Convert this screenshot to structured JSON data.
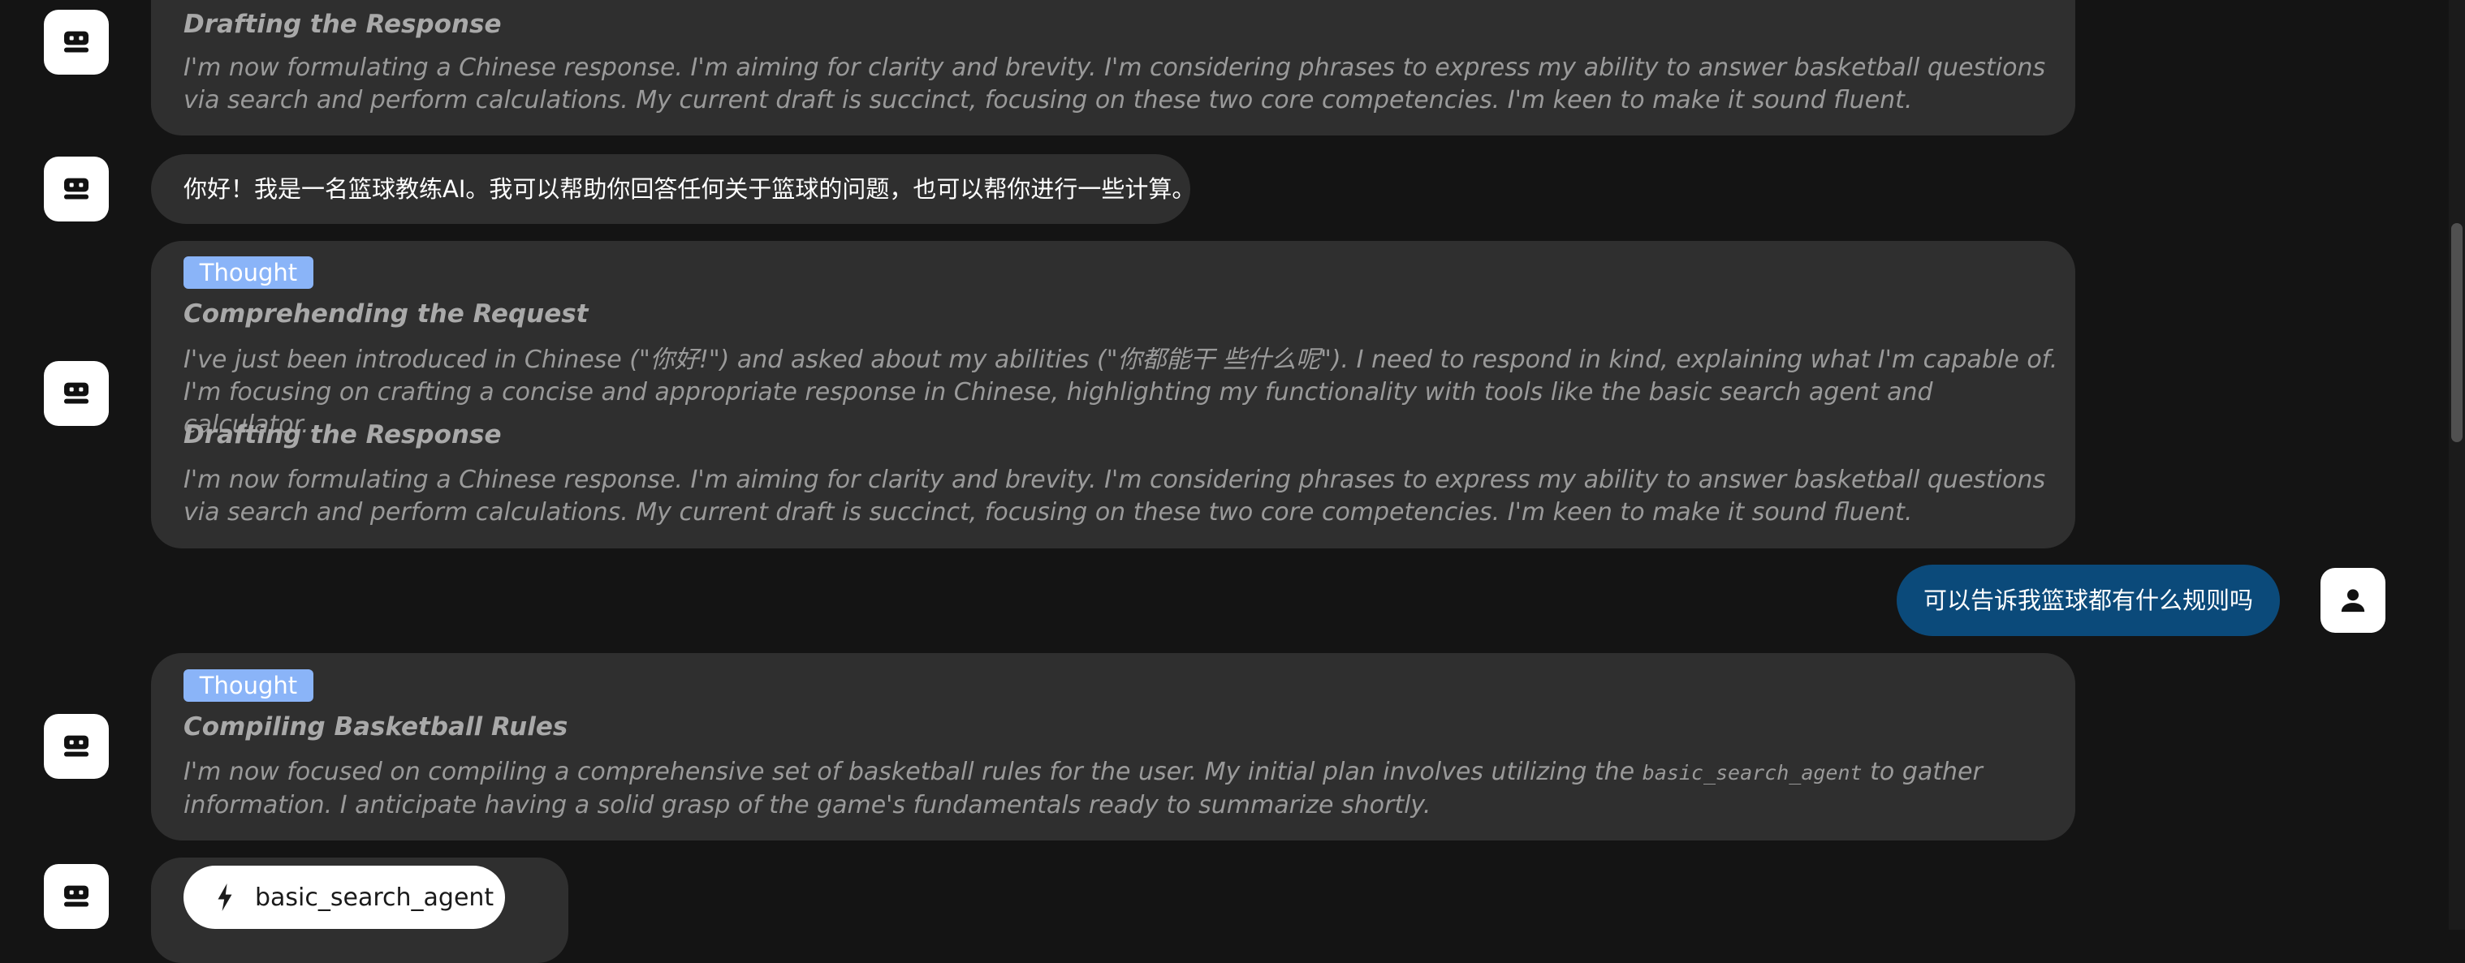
{
  "messages": {
    "m1": {
      "sections": [
        {
          "title": "Drafting the Response",
          "text": "I'm now formulating a Chinese response. I'm aiming for clarity and brevity. I'm considering phrases to express my ability to answer basketball questions via search and perform calculations. My current draft is succinct, focusing on these two core competencies. I'm keen to make it sound fluent."
        }
      ]
    },
    "m2": {
      "text": "你好！我是一名篮球教练AI。我可以帮助你回答任何关于篮球的问题，也可以帮你进行一些计算。"
    },
    "m3": {
      "tag": "Thought",
      "sections": [
        {
          "title": "Comprehending the Request",
          "text": "I've just been introduced in Chinese (\"你好!\") and asked about my abilities (\"你都能干 些什么呢\"). I need to respond in kind, explaining what I'm capable of. I'm focusing on crafting a concise and appropriate response in Chinese, highlighting my functionality with tools like the basic search agent and calculator."
        },
        {
          "title": "Drafting the Response",
          "text": "I'm now formulating a Chinese response. I'm aiming for clarity and brevity. I'm considering phrases to express my ability to answer basketball questions via search and perform calculations. My current draft is succinct, focusing on these two core competencies. I'm keen to make it sound fluent."
        }
      ]
    },
    "user": {
      "text": "可以告诉我篮球都有什么规则吗"
    },
    "m4": {
      "tag": "Thought",
      "title": "Compiling Basketball Rules",
      "text_before": "I'm now focused on compiling a comprehensive set of basketball rules for the user. My initial plan involves utilizing the ",
      "code": "basic_search_agent",
      "text_after": " to gather information. I anticipate having a solid grasp of the game's fundamentals ready to summarize shortly."
    },
    "m5": {
      "tool_label": "basic_search_agent"
    }
  },
  "icons": {
    "assistant": "robot-icon",
    "user": "person-icon",
    "tool": "lightning-bolt-icon"
  },
  "colors": {
    "background": "#141414",
    "bubble": "#2f2f2f",
    "user_bubble": "#0b4a7a",
    "thought_tag": "#8ab4f8"
  }
}
